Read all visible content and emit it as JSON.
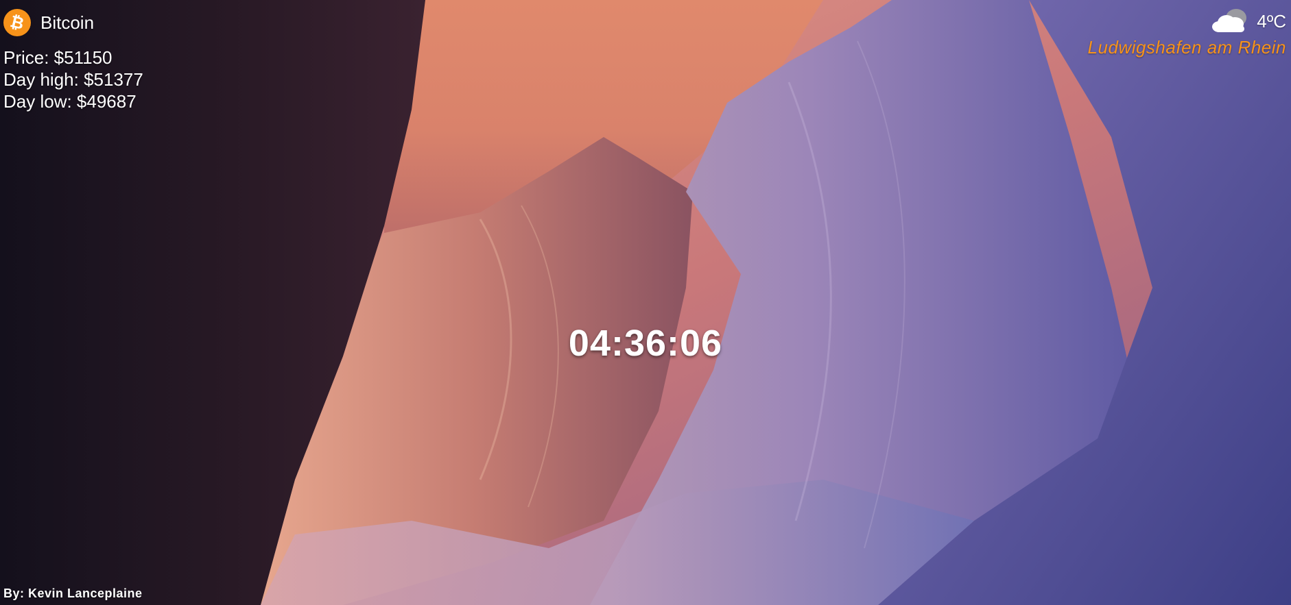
{
  "crypto": {
    "icon": "bitcoin-icon",
    "name": "Bitcoin",
    "price": "Price: $51150",
    "day_high": "Day high: $51377",
    "day_low": "Day low: $49687",
    "accent_color": "#f7931a"
  },
  "weather": {
    "icon": "cloud-icon",
    "temperature": "4ºC",
    "city": "Ludwigshafen am Rhein",
    "city_color": "#f7931a"
  },
  "clock": {
    "time": "04:36:06"
  },
  "background": {
    "description_icon": "canyon-background-image",
    "credit": "By: Kevin Lanceplaine"
  }
}
